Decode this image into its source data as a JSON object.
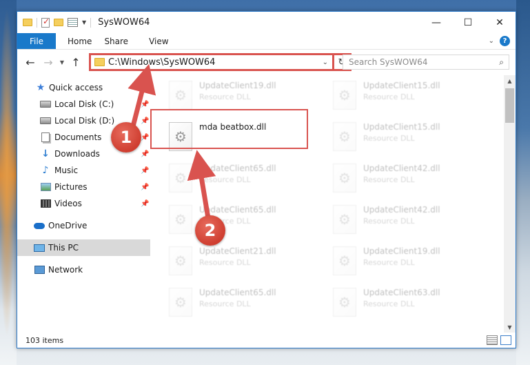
{
  "window": {
    "title": "SysWOW64"
  },
  "ribbon": {
    "tabs": [
      "File",
      "Home",
      "Share",
      "View"
    ],
    "help": "?"
  },
  "navigation": {
    "address_path": "C:\\Windows\\SysWOW64",
    "search_placeholder": "Search SysWOW64"
  },
  "sidebar": {
    "items": [
      {
        "label": "Quick access",
        "icon": "star-icon"
      },
      {
        "label": "Local Disk (C:)",
        "icon": "disk-icon",
        "pinned": true
      },
      {
        "label": "Local Disk (D:)",
        "icon": "disk-icon",
        "pinned": true
      },
      {
        "label": "Documents",
        "icon": "documents-icon",
        "pinned": true
      },
      {
        "label": "Downloads",
        "icon": "downloads-icon",
        "pinned": true
      },
      {
        "label": "Music",
        "icon": "music-icon",
        "pinned": true
      },
      {
        "label": "Pictures",
        "icon": "pictures-icon",
        "pinned": true
      },
      {
        "label": "Videos",
        "icon": "videos-icon",
        "pinned": true
      },
      {
        "label": "OneDrive",
        "icon": "onedrive-icon"
      },
      {
        "label": "This PC",
        "icon": "pc-icon",
        "selected": true
      },
      {
        "label": "Network",
        "icon": "network-icon"
      }
    ]
  },
  "files": [
    {
      "name": "UpdateClient19.dll",
      "type": "Resource DLL"
    },
    {
      "name": "UpdateClient15.dll",
      "type": "Resource DLL"
    },
    {
      "name": "mda beatbox.dll",
      "type": ""
    },
    {
      "name": "UpdateClient15.dll",
      "type": "Resource DLL"
    },
    {
      "name": "UpdateClient65.dll",
      "type": "Resource DLL"
    },
    {
      "name": "UpdateClient42.dll",
      "type": "Resource DLL"
    },
    {
      "name": "UpdateClient65.dll",
      "type": "Resource DLL"
    },
    {
      "name": "UpdateClient42.dll",
      "type": "Resource DLL"
    },
    {
      "name": "UpdateClient21.dll",
      "type": "Resource DLL"
    },
    {
      "name": "UpdateClient19.dll",
      "type": "Resource DLL"
    },
    {
      "name": "UpdateClient65.dll",
      "type": "Resource DLL"
    },
    {
      "name": "UpdateClient63.dll",
      "type": "Resource DLL"
    }
  ],
  "status": {
    "item_count": "103 items"
  },
  "annotations": {
    "step1": "1",
    "step2": "2",
    "color": "#d9534f"
  }
}
